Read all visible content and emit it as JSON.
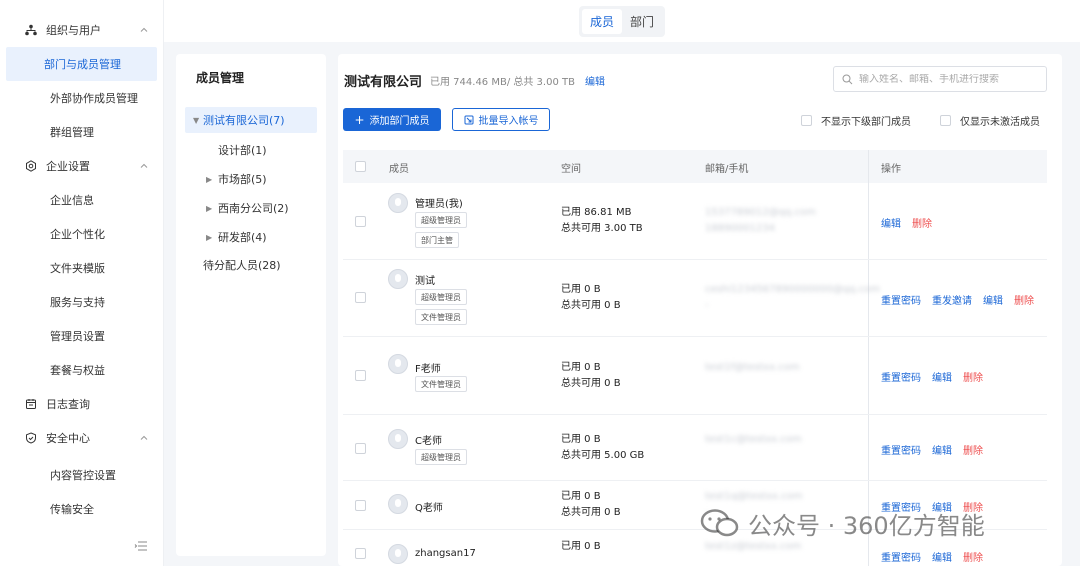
{
  "sidebar": {
    "groups": [
      {
        "label": "组织与用户",
        "icon": "org-icon",
        "items": [
          "部门与成员管理",
          "外部协作成员管理",
          "群组管理"
        ]
      },
      {
        "label": "企业设置",
        "icon": "gear-icon",
        "items": [
          "企业信息",
          "企业个性化",
          "文件夹模版",
          "服务与支持",
          "管理员设置",
          "套餐与权益"
        ]
      },
      {
        "label": "日志查询",
        "icon": "calendar-icon",
        "items": []
      },
      {
        "label": "安全中心",
        "icon": "shield-icon",
        "items": [
          "内容管控设置",
          "传输安全"
        ]
      }
    ]
  },
  "topbar": {
    "tabs": [
      "成员",
      "部门"
    ],
    "active": "成员"
  },
  "tree": {
    "title": "成员管理",
    "nodes": [
      "测试有限公司(7)",
      "设计部(1)",
      "市场部(5)",
      "西南分公司(2)",
      "研发部(4)",
      "待分配人员(28)"
    ]
  },
  "main": {
    "company": "测试有限公司",
    "usage": "已用 744.46 MB/ 总共 3.00 TB",
    "edit": "编辑",
    "search_placeholder": "输入姓名、邮箱、手机进行搜索",
    "add_button": "添加部门成员",
    "import_button": "批量导入帐号",
    "opt_hide_sub": "不显示下级部门成员",
    "opt_only_inactive": "仅显示未激活成员",
    "columns": [
      "成员",
      "空间",
      "邮箱/手机",
      "操作"
    ],
    "rows": [
      {
        "name": "管理员(我)",
        "tags": [
          "超级管理员",
          "部门主管"
        ],
        "used": "已用 86.81 MB",
        "total": "总共可用 3.00 TB",
        "email": "1537789012@qq.com",
        "email2": "18890001234",
        "ops": [
          "编辑",
          "删除"
        ]
      },
      {
        "name": "测试",
        "tags": [
          "超级管理员",
          "文件管理员"
        ],
        "used": "已用 0 B",
        "total": "总共可用 0 B",
        "email": "ceshi1234567890000000@qq.com",
        "email2": "-",
        "ops": [
          "重置密码",
          "重发邀请",
          "编辑",
          "删除"
        ]
      },
      {
        "name": "F老师",
        "tags": [
          "文件管理员"
        ],
        "used": "已用 0 B",
        "total": "总共可用 0 B",
        "email": "test1f@testxx.com",
        "email2": "",
        "ops": [
          "重置密码",
          "编辑",
          "删除"
        ]
      },
      {
        "name": "C老师",
        "tags": [
          "超级管理员"
        ],
        "used": "已用 0 B",
        "total": "总共可用 5.00 GB",
        "email": "test1c@testxx.com",
        "email2": "",
        "ops": [
          "重置密码",
          "编辑",
          "删除"
        ]
      },
      {
        "name": "Q老师",
        "tags": [],
        "used": "已用 0 B",
        "total": "总共可用 0 B",
        "email": "test1q@testxx.com",
        "email2": "-",
        "ops": [
          "重置密码",
          "编辑",
          "删除"
        ]
      },
      {
        "name": "zhangsan17",
        "tags": [],
        "used": "已用 0 B",
        "total": "",
        "email": "test1z@testxx.com",
        "email2": "",
        "ops": [
          "重置密码",
          "编辑",
          "删除"
        ]
      }
    ]
  },
  "watermark": "公众号 · 360亿方智能"
}
